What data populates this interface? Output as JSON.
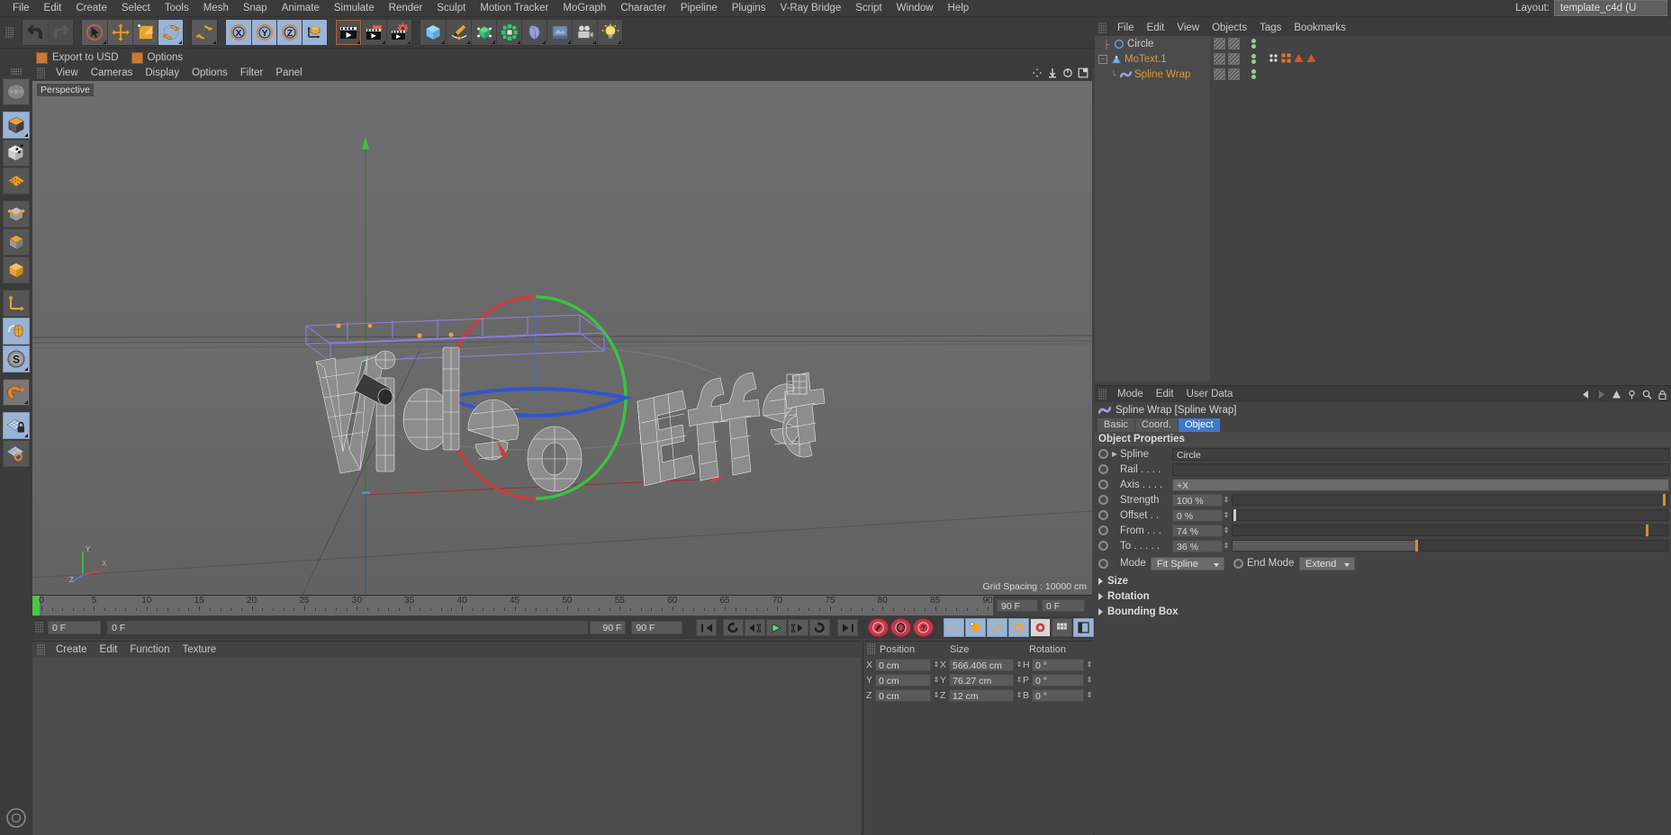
{
  "menubar": {
    "items": [
      "File",
      "Edit",
      "Create",
      "Select",
      "Tools",
      "Mesh",
      "Snap",
      "Animate",
      "Simulate",
      "Render",
      "Sculpt",
      "Motion Tracker",
      "MoGraph",
      "Character",
      "Pipeline",
      "Plugins",
      "V-Ray Bridge",
      "Script",
      "Window",
      "Help"
    ],
    "layout_label": "Layout:",
    "layout_value": "template_c4d (U"
  },
  "toolbar": {
    "undo": "undo-arrow",
    "redo": "redo-arrow",
    "select": "live-selection",
    "move": "move-tool",
    "scale": "scale-tool",
    "rotate": "rotate-tool",
    "rotate_alt": "rotate-band-tool",
    "axis_x": "X",
    "axis_y": "Y",
    "axis_z": "Z",
    "world_axis": "world-object-axis",
    "render_view": "render-view",
    "render_region": "render-to-picture-viewer",
    "render_settings": "render-settings",
    "cube": "add-cube",
    "spline": "add-spline",
    "nurbs": "add-generator",
    "array": "add-array",
    "bend": "add-deformer",
    "floor": "add-environment",
    "camera": "add-camera",
    "light": "add-light"
  },
  "subbar": {
    "items": [
      {
        "label": "Export to USD",
        "icon": "usd-export-icon"
      },
      {
        "label": "Options",
        "icon": "options-icon"
      }
    ]
  },
  "lefttools": {
    "items": [
      {
        "name": "make-editable",
        "active": false
      },
      {
        "name": "model-mode",
        "active": true
      },
      {
        "name": "texture-mode",
        "active": false
      },
      {
        "name": "points-mode",
        "active": false
      },
      {
        "name": "edges-mode",
        "active": false
      },
      {
        "name": "polygons-mode",
        "active": false
      },
      {
        "name": "object-axis-mode",
        "active": false
      },
      {
        "name": "world-axis-icon",
        "active": false
      },
      {
        "name": "enable-axis-icon",
        "active": true
      },
      {
        "name": "soft-selection-icon",
        "active": true
      },
      {
        "name": "magnet-icon",
        "active": false
      },
      {
        "name": "workplane-lock-icon",
        "active": true
      },
      {
        "name": "workplane-rotate-icon",
        "active": false
      }
    ]
  },
  "viewport": {
    "menu": [
      "View",
      "Cameras",
      "Display",
      "Options",
      "Filter",
      "Panel"
    ],
    "label": "Perspective",
    "grid_spacing": "Grid Spacing : 10000 cm",
    "text_object": "Video Effect"
  },
  "timeline": {
    "ticks": [
      0,
      5,
      10,
      15,
      20,
      25,
      30,
      35,
      40,
      45,
      50,
      55,
      60,
      65,
      70,
      75,
      80,
      85,
      90
    ],
    "current_frame": "0 F",
    "end_frame": "90 F"
  },
  "transport": {
    "start_field": "0 F",
    "current_field": "0 F",
    "range_end": "90 F",
    "range_max": "90 F",
    "buttons": [
      {
        "name": "go-to-start-button",
        "glyph": "|◀◀"
      },
      {
        "name": "previous-key-button",
        "glyph": "↺"
      },
      {
        "name": "step-back-button",
        "glyph": "◀|"
      },
      {
        "name": "play-button",
        "glyph": "▶"
      },
      {
        "name": "step-forward-button",
        "glyph": "|▶"
      },
      {
        "name": "next-key-button",
        "glyph": "↻"
      },
      {
        "name": "go-to-end-button",
        "glyph": "▶▶|"
      }
    ],
    "record_buttons": [
      {
        "name": "record-active-objects-button"
      },
      {
        "name": "autokeying-button"
      },
      {
        "name": "keyframe-selection-button"
      }
    ],
    "toggle_buttons": [
      {
        "name": "position-key-button"
      },
      {
        "name": "scale-key-button"
      },
      {
        "name": "rotation-key-button"
      },
      {
        "name": "parameter-key-button"
      },
      {
        "name": "point-level-animation-button"
      },
      {
        "name": "timeline-toggle-button"
      },
      {
        "name": "layout-toggle-button"
      }
    ]
  },
  "material_manager": {
    "menu": [
      "Create",
      "Edit",
      "Function",
      "Texture"
    ]
  },
  "coordinate_manager": {
    "headers": [
      "Position",
      "Size",
      "Rotation"
    ],
    "rows": [
      {
        "axis": "X",
        "position": "0 cm",
        "size_axis": "X",
        "size": "566.406 cm",
        "rot_axis": "H",
        "rotation": "0 °"
      },
      {
        "axis": "Y",
        "position": "0 cm",
        "size_axis": "Y",
        "size": "76.27 cm",
        "rot_axis": "P",
        "rotation": "0 °"
      },
      {
        "axis": "Z",
        "position": "0 cm",
        "size_axis": "Z",
        "size": "12 cm",
        "rot_axis": "B",
        "rotation": "0 °"
      }
    ]
  },
  "object_manager": {
    "menu": [
      "File",
      "Edit",
      "View",
      "Objects",
      "Tags",
      "Bookmarks"
    ],
    "objects": [
      {
        "name": "Circle",
        "icon": "circle-spline-icon",
        "color": "#9fb8d8",
        "indent": 0,
        "expander": "",
        "tags": []
      },
      {
        "name": "MoText.1",
        "icon": "motext-icon",
        "color": "#d99a3c",
        "indent": 0,
        "expander": "−",
        "tags": [
          "mograph-tag",
          "effector-tag",
          "up-tag",
          "up-tag-2"
        ]
      },
      {
        "name": "Spline Wrap",
        "icon": "spline-wrap-icon",
        "color": "#d99a3c",
        "indent": 1,
        "expander": "",
        "tags": []
      }
    ]
  },
  "attribute_manager": {
    "menu": [
      "Mode",
      "Edit",
      "User Data"
    ],
    "title": "Spline Wrap [Spline Wrap]",
    "icon": "spline-wrap-icon",
    "tabs": [
      {
        "label": "Basic",
        "active": false
      },
      {
        "label": "Coord.",
        "active": false
      },
      {
        "label": "Object",
        "active": true
      }
    ],
    "section": "Object Properties",
    "properties": [
      {
        "label": "Spline",
        "type": "link",
        "value": "Circle",
        "arrow": true
      },
      {
        "label": "Rail . . . .",
        "type": "link",
        "value": "",
        "arrow": false
      },
      {
        "label": "Axis . . . .",
        "type": "button",
        "value": "+X"
      },
      {
        "label": "Strength",
        "type": "slider",
        "value": "100 %",
        "pct": 100,
        "knob": 100
      },
      {
        "label": "Offset . .",
        "type": "slider",
        "value": "0 %",
        "pct": 0,
        "knob": 0
      },
      {
        "label": "From . . .",
        "type": "slider",
        "value": "74 %",
        "pct": 74,
        "knob": 96
      },
      {
        "label": "To . . . . .",
        "type": "slider",
        "value": "36 %",
        "pct": 36,
        "knob": 42
      }
    ],
    "mode_label": "Mode",
    "mode_value": "Fit Spline",
    "endmode_label": "End Mode",
    "endmode_value": "Extend",
    "folders": [
      "Size",
      "Rotation",
      "Bounding Box"
    ]
  }
}
